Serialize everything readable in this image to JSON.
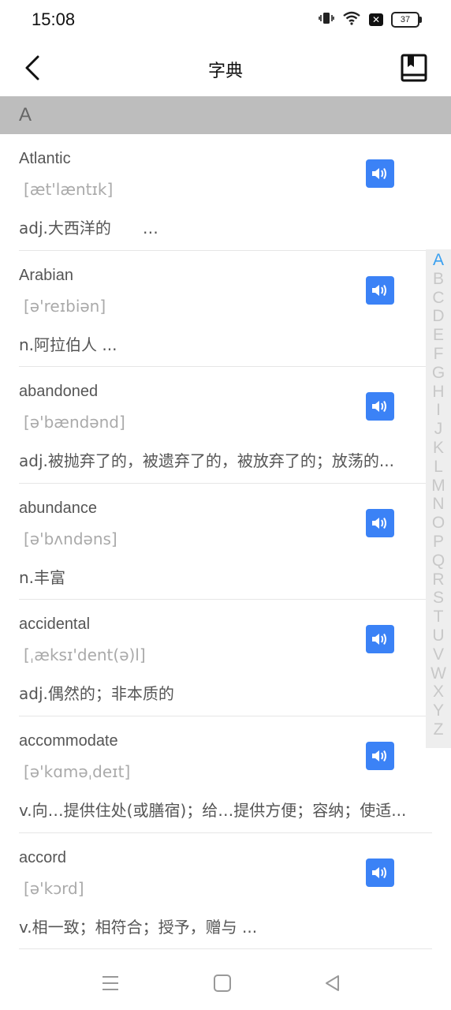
{
  "status": {
    "time": "15:08",
    "battery": "37"
  },
  "header": {
    "title": "字典"
  },
  "section": {
    "letter": "A"
  },
  "entries": [
    {
      "word": "Atlantic",
      "phonetic": "[æt'læntɪk]",
      "meaning": "adj.大西洋的　　…"
    },
    {
      "word": "Arabian",
      "phonetic": "[ə'reɪbiən]",
      "meaning": "n.阿拉伯人 ..."
    },
    {
      "word": "abandoned",
      "phonetic": "[ə'bændənd]",
      "meaning": "adj.被抛弃了的，被遗弃了的，被放弃了的；放荡的..."
    },
    {
      "word": "abundance",
      "phonetic": "[ə'bʌndəns]",
      "meaning": "n.丰富"
    },
    {
      "word": "accidental",
      "phonetic": "[ˌæksɪ'dent(ə)l]",
      "meaning": "adj.偶然的；非本质的"
    },
    {
      "word": "accommodate",
      "phonetic": "[ə'kɑməˌdeɪt]",
      "meaning": "v.向…提供住处(或膳宿)；给…提供方便；容纳；使适..."
    },
    {
      "word": "accord",
      "phonetic": "[ə'kɔrd]",
      "meaning": "v.相一致；相符合；授予，赠与 ..."
    }
  ],
  "index_letters": [
    "A",
    "B",
    "C",
    "D",
    "E",
    "F",
    "G",
    "H",
    "I",
    "J",
    "K",
    "L",
    "M",
    "N",
    "O",
    "P",
    "Q",
    "R",
    "S",
    "T",
    "U",
    "V",
    "W",
    "X",
    "Y",
    "Z"
  ],
  "icons": {
    "back": "chevron-left-icon",
    "book": "book-icon",
    "speaker": "speaker-icon"
  },
  "colors": {
    "accent": "#3b82f6",
    "index_active": "#3aa0f0",
    "section_bg": "#bdbdbd"
  }
}
